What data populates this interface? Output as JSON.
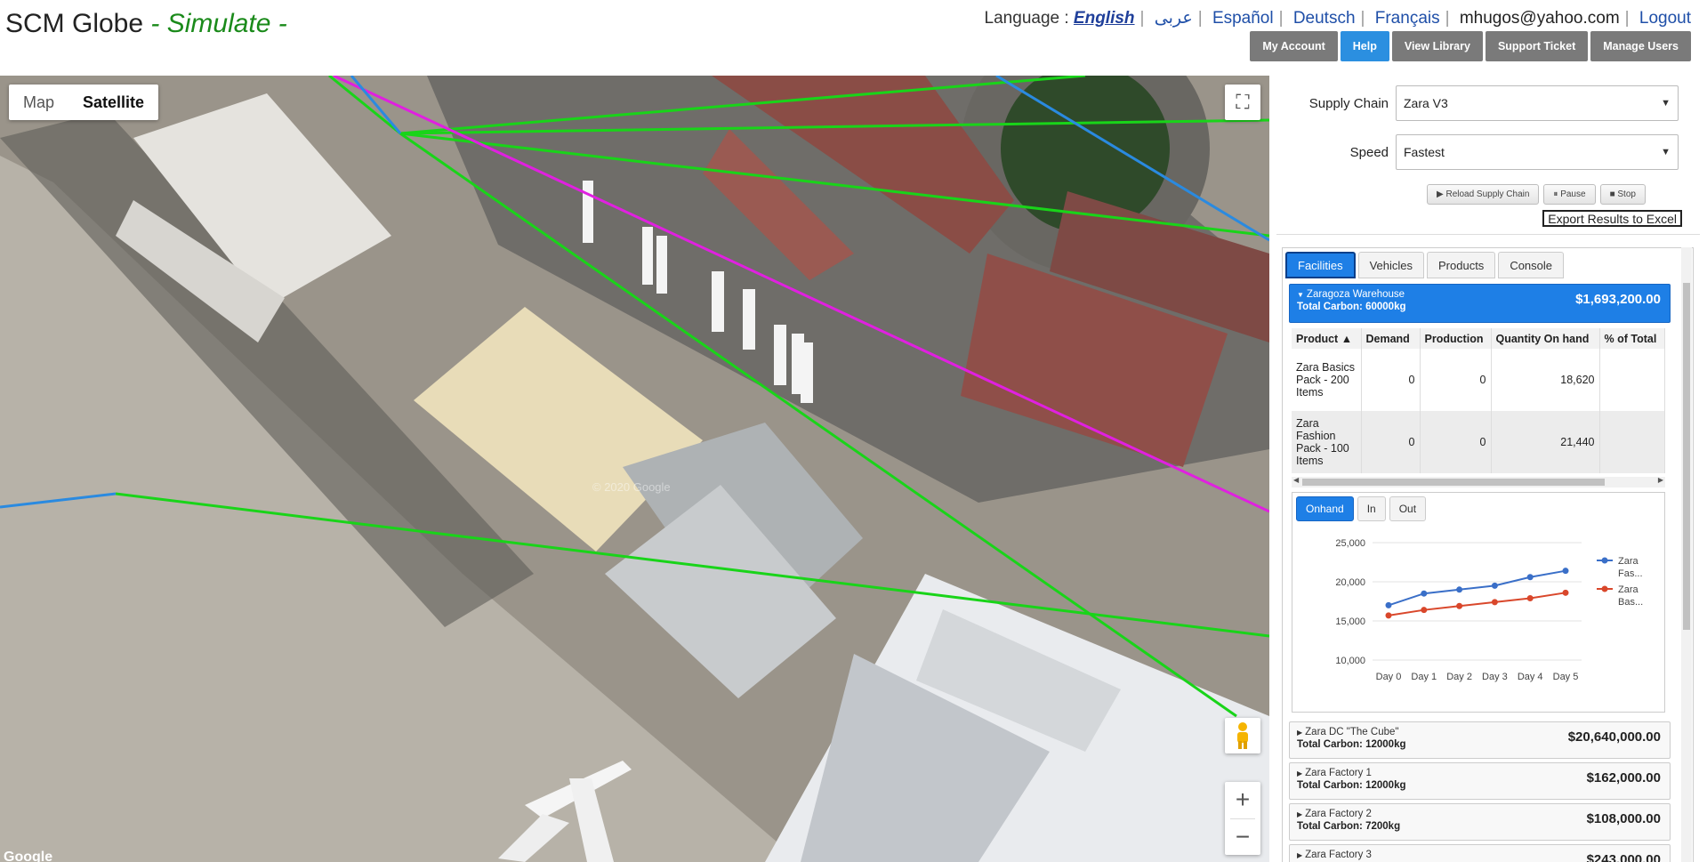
{
  "header": {
    "brand": "SCM Globe",
    "mode": " - Simulate -",
    "language_label": "Language :",
    "languages": [
      "English",
      "عربى",
      "Español",
      "Deutsch",
      "Français"
    ],
    "email": "mhugos@yahoo.com",
    "logout": "Logout",
    "nav": [
      "My Account",
      "Help",
      "View Library",
      "Support Ticket",
      "Manage Users"
    ],
    "nav_active": "Help"
  },
  "map": {
    "type_map": "Map",
    "type_satellite": "Satellite",
    "watermark": "© 2020 Google",
    "google": "Google",
    "zoom_in": "+",
    "zoom_out": "−"
  },
  "panel": {
    "supply_chain_label": "Supply Chain",
    "supply_chain_value": "Zara V3",
    "speed_label": "Speed",
    "speed_value": "Fastest",
    "reload": "▶ Reload Supply Chain",
    "pause": "⏸ Pause",
    "stop": "■ Stop",
    "export": "Export Results to Excel",
    "tabs": [
      "Facilities",
      "Vehicles",
      "Products",
      "Console"
    ],
    "active_tab": "Facilities"
  },
  "facilities": [
    {
      "name": "Zaragoza Warehouse",
      "carbon": "Total Carbon: 60000kg",
      "amount": "$1,693,200.00",
      "open": true
    },
    {
      "name": "Zara DC \"The Cube\"",
      "carbon": "Total Carbon: 12000kg",
      "amount": "$20,640,000.00",
      "open": false
    },
    {
      "name": "Zara Factory 1",
      "carbon": "Total Carbon: 12000kg",
      "amount": "$162,000.00",
      "open": false
    },
    {
      "name": "Zara Factory 2",
      "carbon": "Total Carbon: 7200kg",
      "amount": "$108,000.00",
      "open": false
    },
    {
      "name": "Zara Factory 3",
      "carbon": "",
      "amount": "$243,000.00",
      "open": false
    }
  ],
  "product_table": {
    "headers": [
      "Product ▲",
      "Demand",
      "Production",
      "Quantity On hand",
      "% of Total"
    ],
    "rows": [
      [
        "Zara Basics Pack - 200 Items",
        "0",
        "0",
        "18,620",
        ""
      ],
      [
        "Zara Fashion Pack - 100 Items",
        "0",
        "0",
        "21,440",
        ""
      ]
    ]
  },
  "sub_tabs": [
    "Onhand",
    "In",
    "Out"
  ],
  "active_sub_tab": "Onhand",
  "chart_data": {
    "type": "line",
    "categories": [
      "Day 0",
      "Day 1",
      "Day 2",
      "Day 3",
      "Day 4",
      "Day 5"
    ],
    "series": [
      {
        "name": "Zara Fas...",
        "color": "#3a6fc8",
        "values": [
          17000,
          18500,
          19000,
          19500,
          20600,
          21400
        ]
      },
      {
        "name": "Zara Bas...",
        "color": "#d9472b",
        "values": [
          15700,
          16400,
          16900,
          17400,
          17900,
          18600
        ]
      }
    ],
    "yticks": [
      10000,
      15000,
      20000,
      25000
    ],
    "ytick_labels": [
      "10,000",
      "15,000",
      "20,000",
      "25,000"
    ],
    "ylim": [
      10000,
      25000
    ],
    "legend": "right"
  }
}
